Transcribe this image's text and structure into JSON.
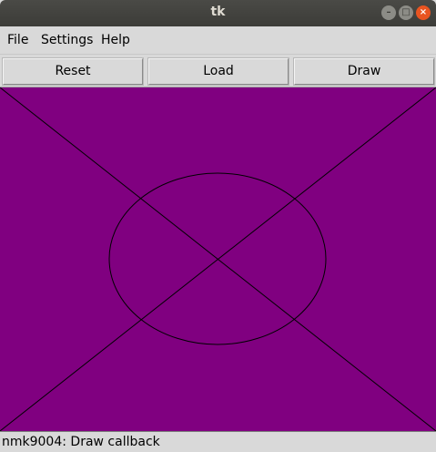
{
  "window": {
    "title": "tk",
    "buttons": {
      "minimize_icon": "minimize-icon",
      "maximize_icon": "maximize-icon",
      "close_icon": "close-icon"
    }
  },
  "menubar": {
    "items": [
      {
        "label": "File"
      },
      {
        "label": "Settings"
      },
      {
        "label": "Help"
      }
    ]
  },
  "toolbar": {
    "reset_label": "Reset",
    "load_label": "Load",
    "draw_label": "Draw"
  },
  "canvas": {
    "background_color": "#800080",
    "stroke_color": "#000000",
    "shapes": [
      "diagonal-line",
      "diagonal-line",
      "ellipse"
    ]
  },
  "statusbar": {
    "text": "nmk9004: Draw callback"
  }
}
